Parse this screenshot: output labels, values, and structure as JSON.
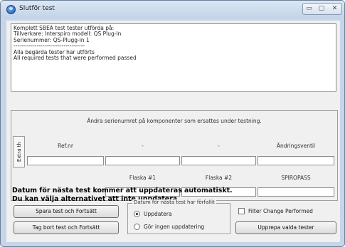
{
  "window": {
    "title": "Slutför test",
    "minimize_label": "▭",
    "maximize_label": "▢",
    "close_label": "✕"
  },
  "log": {
    "lines": [
      "Komplett SBEA test tester utförda på:",
      "Tillverkare: Interspiro modell: QS Plug-In",
      "Serienummer: QS-Plugg-in 1",
      "-------------------------------------",
      "Alla begärda tester har utförts",
      "All required tests that were performed passed"
    ]
  },
  "serial_group": {
    "instruction": "Ändra serienumret på komponenter som ersattes under testning.",
    "side_tab": "Extra th",
    "row1_headers": [
      "Ref.nr",
      "-",
      "-",
      "Ändringsventil"
    ],
    "row2_headers": [
      "Flaska #1",
      "Flaska #2",
      "SPIROPASS"
    ]
  },
  "notice": {
    "line1": "Datum för nästa test kommer att uppdateras automatiskt.",
    "line2": "Du kan välja alternativet att inte uppdatera."
  },
  "buttons": {
    "save_continue": "Spara test och Fortsätt",
    "discard_continue": "Tag bort test och Fortsätt",
    "repeat_tests": "Upprepa valda tester"
  },
  "date_group": {
    "label": "Datum för nästa test har förfallit",
    "options": [
      {
        "label": "Uppdatera",
        "checked": true
      },
      {
        "label": "Gör ingen uppdatering",
        "checked": false
      }
    ]
  },
  "filter": {
    "label": "Filter Change Performed",
    "checked": false
  }
}
